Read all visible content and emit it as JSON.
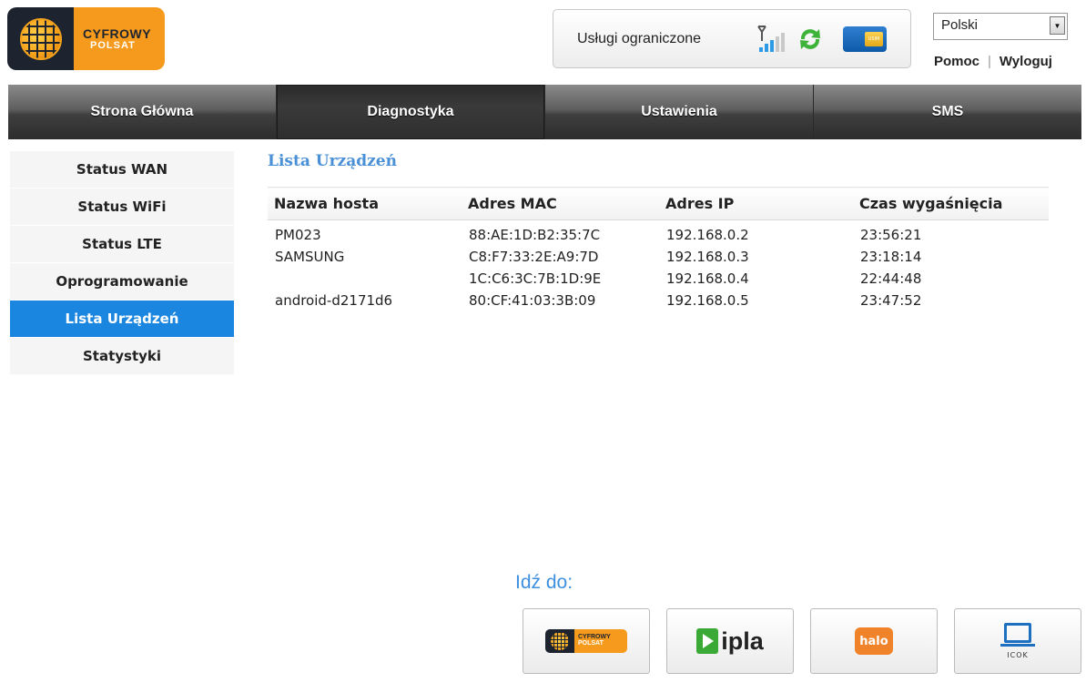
{
  "header": {
    "logo": {
      "line1": "CYFROWY",
      "line2": "POLSAT"
    },
    "status_text": "Usługi ograniczone",
    "usim_label": "USIM",
    "language": "Polski",
    "links": {
      "help": "Pomoc",
      "logout": "Wyloguj"
    }
  },
  "nav": {
    "tabs": [
      {
        "label": "Strona Główna"
      },
      {
        "label": "Diagnostyka"
      },
      {
        "label": "Ustawienia"
      },
      {
        "label": "SMS"
      }
    ]
  },
  "sidebar": {
    "items": [
      {
        "label": "Status WAN"
      },
      {
        "label": "Status WiFi"
      },
      {
        "label": "Status LTE"
      },
      {
        "label": "Oprogramowanie"
      },
      {
        "label": "Lista Urządzeń"
      },
      {
        "label": "Statystyki"
      }
    ]
  },
  "main": {
    "title": "Lista Urządzeń",
    "columns": [
      "Nazwa hosta",
      "Adres MAC",
      "Adres IP",
      "Czas wygaśnięcia"
    ],
    "rows": [
      {
        "host": "PM023",
        "mac": "88:AE:1D:B2:35:7C",
        "ip": "192.168.0.2",
        "expire": "23:56:21"
      },
      {
        "host": "SAMSUNG",
        "mac": "C8:F7:33:2E:A9:7D",
        "ip": "192.168.0.3",
        "expire": "23:18:14"
      },
      {
        "host": "",
        "mac": "1C:C6:3C:7B:1D:9E",
        "ip": "192.168.0.4",
        "expire": "22:44:48"
      },
      {
        "host": "android-d2171d6",
        "mac": "80:CF:41:03:3B:09",
        "ip": "192.168.0.5",
        "expire": "23:47:52"
      }
    ]
  },
  "footer": {
    "goto_label": "Idź do:",
    "links": [
      {
        "name": "cyfrowy-polsat",
        "line1": "CYFROWY",
        "line2": "POLSAT"
      },
      {
        "name": "ipla",
        "text": "ipla"
      },
      {
        "name": "halo",
        "text": "halo"
      },
      {
        "name": "icok",
        "text": "ICOK"
      }
    ]
  },
  "colors": {
    "accent": "#1a86e0",
    "title": "#4a90d6",
    "logo_orange": "#f59a1c",
    "logo_dark": "#1d2430"
  }
}
